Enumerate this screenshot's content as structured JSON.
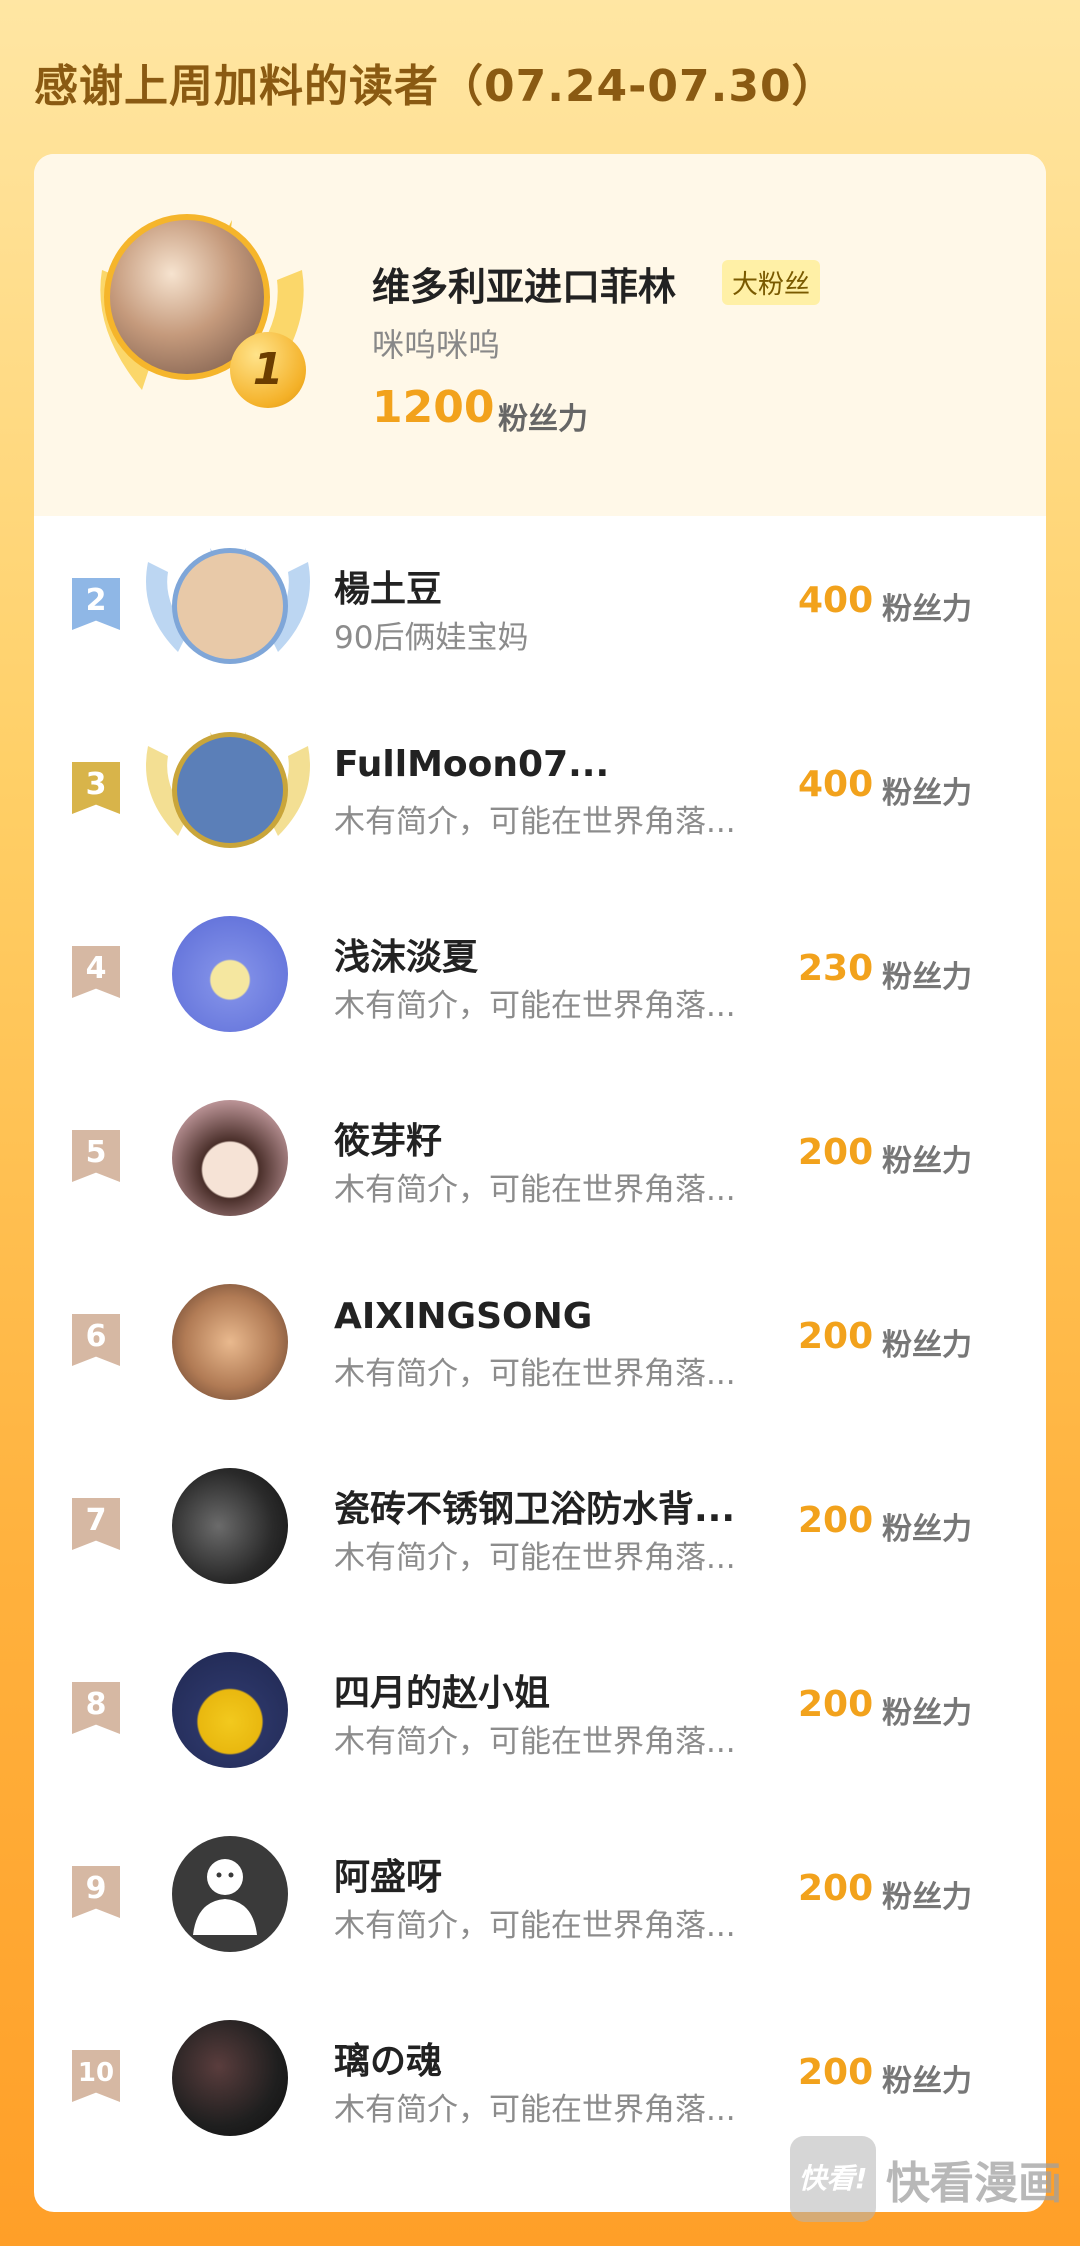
{
  "header": {
    "title": "感谢上周加料的读者（07.24-07.30）"
  },
  "top_reader": {
    "rank": "1",
    "name": "维多利亚进口菲林",
    "tag": "大粉丝",
    "desc": "咪呜咪呜",
    "score": "1200",
    "unit": "粉丝力"
  },
  "rows": [
    {
      "rank": "2",
      "name": "楊土豆",
      "desc": "90后俩娃宝妈",
      "score": "400",
      "unit": "粉丝力",
      "avatar_color": "#e8c9a8"
    },
    {
      "rank": "3",
      "name": "FullMoon07...",
      "desc": "木有简介，可能在世界角落...",
      "score": "400",
      "unit": "粉丝力",
      "avatar_color": "#5b7fb8"
    },
    {
      "rank": "4",
      "name": "浅沫淡夏",
      "desc": "木有简介，可能在世界角落...",
      "score": "230",
      "unit": "粉丝力",
      "avatar_color": "#6c7fe0"
    },
    {
      "rank": "5",
      "name": "筱芽籽",
      "desc": "木有简介，可能在世界角落...",
      "score": "200",
      "unit": "粉丝力",
      "avatar_color": "#f4d7d7"
    },
    {
      "rank": "6",
      "name": "AIXINGSONG",
      "desc": "木有简介，可能在世界角落...",
      "score": "200",
      "unit": "粉丝力",
      "avatar_color": "#9a6a4a"
    },
    {
      "rank": "7",
      "name": "瓷砖不锈钢卫浴防水背...",
      "desc": "木有简介，可能在世界角落...",
      "score": "200",
      "unit": "粉丝力",
      "avatar_color": "#2a2a2a"
    },
    {
      "rank": "8",
      "name": "四月的赵小姐",
      "desc": "木有简介，可能在世界角落...",
      "score": "200",
      "unit": "粉丝力",
      "avatar_color": "#3b4a8a"
    },
    {
      "rank": "9",
      "name": "阿盛呀",
      "desc": "木有简介，可能在世界角落...",
      "score": "200",
      "unit": "粉丝力",
      "avatar_color": "#3a3a3a"
    },
    {
      "rank": "10",
      "name": "璃の魂",
      "desc": "木有简介，可能在世界角落...",
      "score": "200",
      "unit": "粉丝力",
      "avatar_color": "#1f1f1f"
    }
  ],
  "watermark": {
    "logo": "快看!",
    "text": "快看漫画"
  },
  "colors": {
    "accent": "#f2a21c",
    "rank2": "#8fb7e6",
    "rank3": "#d8b44a",
    "rank_other": "#d6b8a3"
  }
}
